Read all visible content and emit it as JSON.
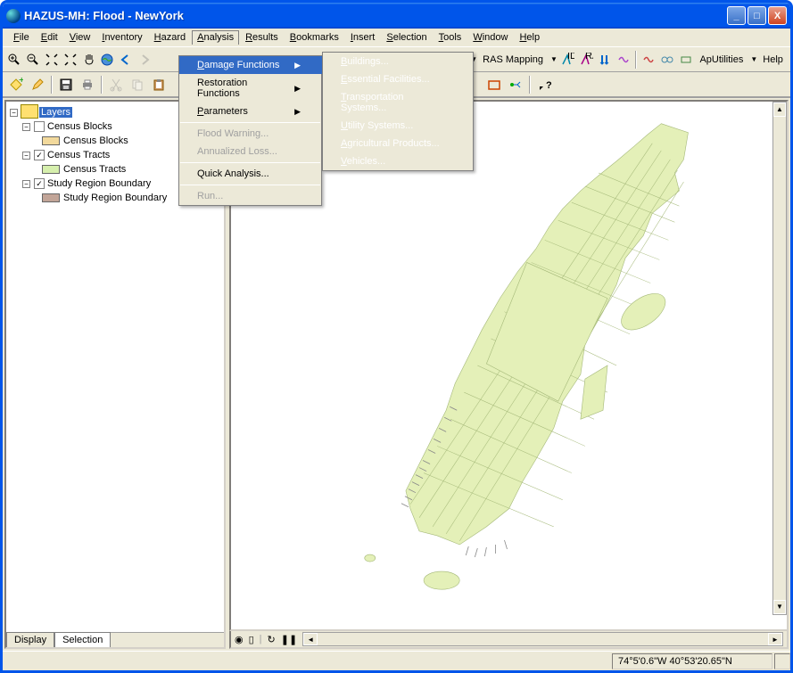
{
  "window": {
    "title": "HAZUS-MH: Flood - NewYork"
  },
  "menubar": {
    "file": "File",
    "edit": "Edit",
    "view": "View",
    "inventory": "Inventory",
    "hazard": "Hazard",
    "analysis": "Analysis",
    "results": "Results",
    "bookmarks": "Bookmarks",
    "insert": "Insert",
    "selection": "Selection",
    "tools": "Tools",
    "window": "Window",
    "help": "Help"
  },
  "analysis_menu": {
    "damage_functions": "Damage Functions",
    "restoration_functions": "Restoration Functions",
    "parameters": "Parameters",
    "flood_warning": "Flood Warning...",
    "annualized_loss": "Annualized Loss...",
    "quick_analysis": "Quick Analysis...",
    "run": "Run..."
  },
  "damage_submenu": {
    "buildings": "Buildings...",
    "essential": "Essential Facilities...",
    "transportation": "Transportation Systems...",
    "utility": "Utility Systems...",
    "agricultural": "Agricultural Products...",
    "vehicles": "Vehicles..."
  },
  "toolbar2": {
    "ras_mapping": "RAS Mapping",
    "ap_utilities": "ApUtilities",
    "help": "Help"
  },
  "layers": {
    "root": "Layers",
    "census_blocks": "Census Blocks",
    "census_blocks_swatch": "Census Blocks",
    "census_tracts": "Census Tracts",
    "census_tracts_swatch": "Census Tracts",
    "study_region": "Study Region Boundary",
    "study_region_swatch": "Study Region Boundary"
  },
  "tree_state": {
    "census_blocks_checked": false,
    "census_tracts_checked": true,
    "study_region_checked": true
  },
  "tabs": {
    "display": "Display",
    "selection": "Selection"
  },
  "status": {
    "coords": "74°5'0.6\"W  40°53'20.65\"N"
  }
}
